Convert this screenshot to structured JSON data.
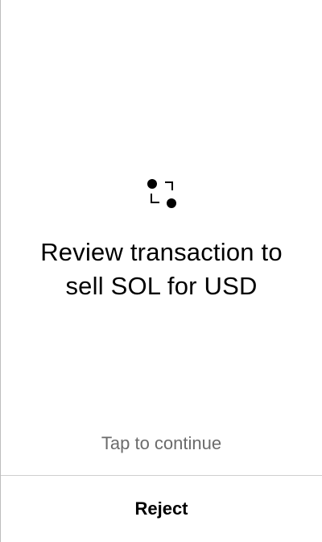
{
  "review": {
    "icon": "swap-icon",
    "title_line1": "Review transaction to",
    "title_line2": "sell SOL for USD",
    "tap_hint": "Tap to continue"
  },
  "footer": {
    "reject_label": "Reject"
  }
}
